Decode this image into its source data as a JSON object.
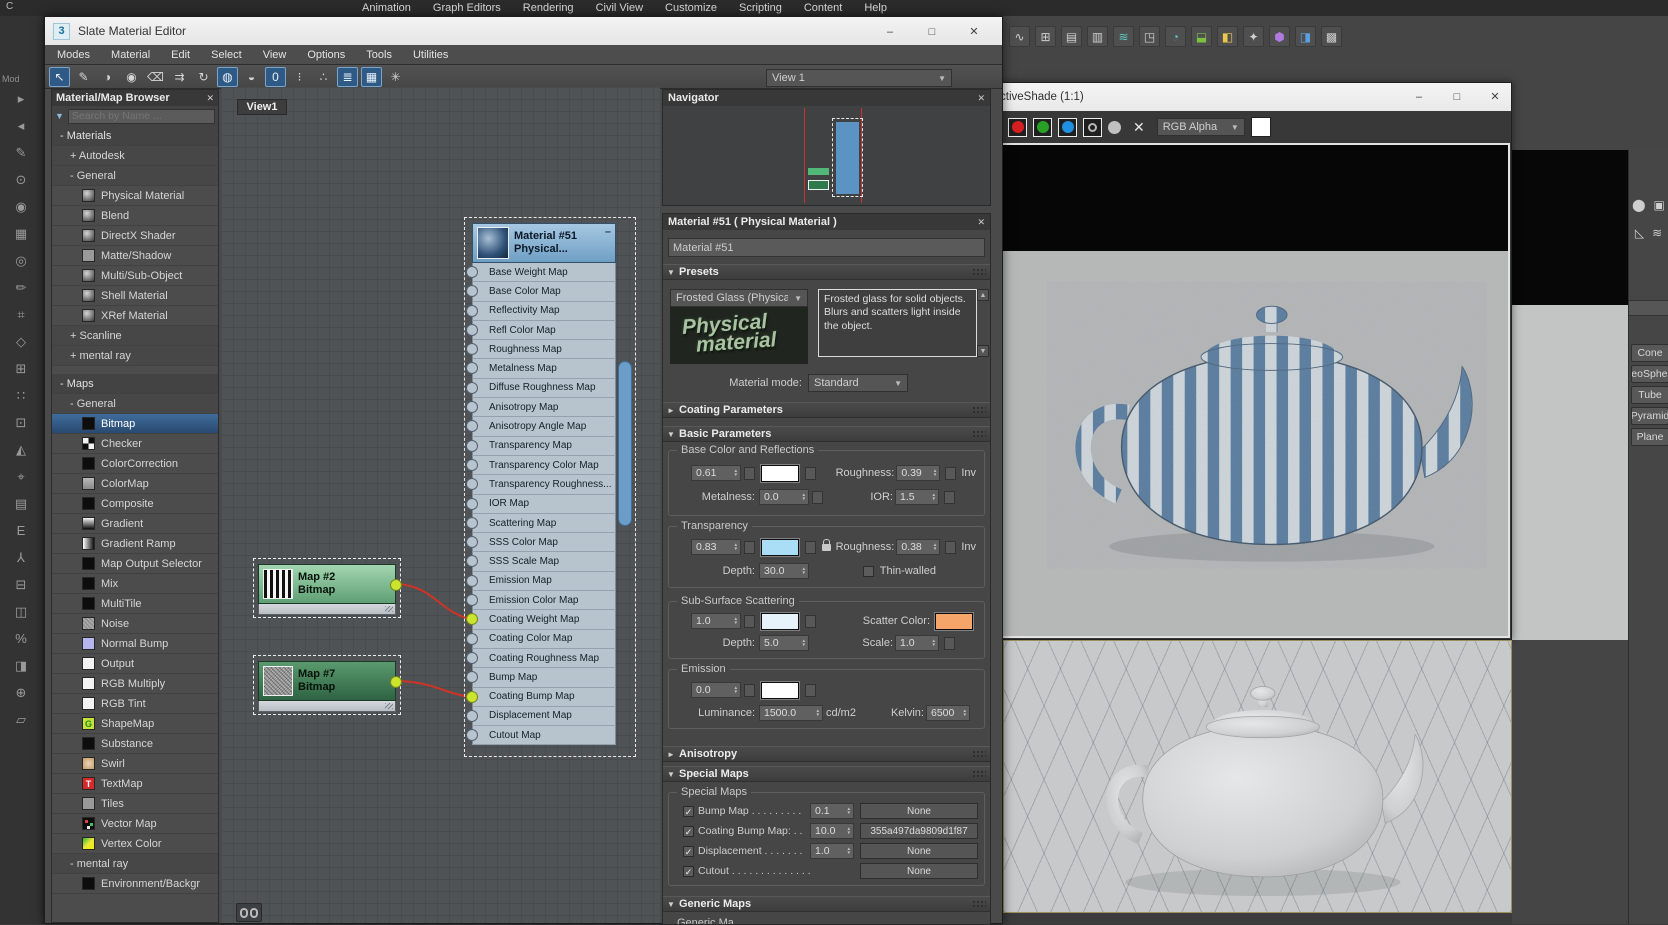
{
  "main_window": {
    "menubar": [
      "Animation",
      "Graph Editors",
      "Rendering",
      "Civil View",
      "Customize",
      "Scripting",
      "Content",
      "Help"
    ],
    "corner_text": "C",
    "mod_text": "Mod",
    "toolbar_icons": [
      {
        "name": "curve-editor-icon",
        "g": "∿",
        "c": ""
      },
      {
        "name": "schematic-view-icon",
        "g": "⊞",
        "c": ""
      },
      {
        "name": "layer-manager-icon",
        "g": "▤",
        "c": ""
      },
      {
        "name": "ribbon-icon",
        "g": "▥",
        "c": ""
      },
      {
        "name": "array-icon",
        "g": "≋",
        "c": "tc-teal"
      },
      {
        "name": "align-icon",
        "g": "◳",
        "c": ""
      },
      {
        "name": "render-setup-icon",
        "g": "◔",
        "c": "tc-teal"
      },
      {
        "name": "rendered-frame-icon",
        "g": "⬓",
        "c": "tc-green"
      },
      {
        "name": "render-production-icon",
        "g": "◧",
        "c": "tc-yellow"
      },
      {
        "name": "render-iterative-icon",
        "g": "✦",
        "c": ""
      },
      {
        "name": "material-editor-icon",
        "g": "⬢",
        "c": "tc-purple"
      },
      {
        "name": "render-preview-icon",
        "g": "◨",
        "c": "tc-blue"
      },
      {
        "name": "grid-icon",
        "g": "▩",
        "c": ""
      }
    ],
    "left_strip_icons": [
      "▸",
      "◂",
      "✎",
      "⊙",
      "◉",
      "▦",
      "◎",
      "✏",
      "⌗",
      "◇",
      "⊞",
      "∷",
      "⊡",
      "◭",
      "⌖",
      "▤",
      "E",
      "⅄",
      "⊟",
      "◫",
      "%",
      "◨",
      "⊕",
      "▱"
    ]
  },
  "command_panel": {
    "icons_row1": [
      "⬤",
      "▣"
    ],
    "icons_row2": [
      "◺",
      "≋"
    ],
    "buttons": [
      "Cone",
      "GeoSphere",
      "Tube",
      "Pyramid",
      "Plane"
    ]
  },
  "slate": {
    "title": "Slate Material Editor",
    "win_min": "–",
    "win_max": "□",
    "win_close": "✕",
    "menubar": [
      "Modes",
      "Material",
      "Edit",
      "Select",
      "View",
      "Options",
      "Tools",
      "Utilities"
    ],
    "toolbar_icons": [
      {
        "name": "select-tool-icon",
        "g": "↖",
        "cls": "pressed"
      },
      {
        "name": "pick-material-icon",
        "g": "✎",
        "cls": ""
      },
      {
        "name": "put-to-library-icon",
        "g": "◑",
        "cls": ""
      },
      {
        "name": "assign-material-icon",
        "g": "◉",
        "cls": ""
      },
      {
        "name": "delete-selected-icon",
        "g": "⌫",
        "cls": ""
      },
      {
        "name": "move-children-icon",
        "g": "⇉",
        "cls": ""
      },
      {
        "name": "update-preview-icon",
        "g": "↻",
        "cls": ""
      },
      {
        "name": "show-map-in-viewport-icon",
        "g": "◍",
        "cls": "pressed"
      },
      {
        "name": "show-background-icon",
        "g": "◒",
        "cls": ""
      },
      {
        "name": "show-numbers-icon",
        "g": "0",
        "cls": "pressed"
      },
      {
        "name": "layout-vertical-icon",
        "g": "⁝",
        "cls": ""
      },
      {
        "name": "layout-children-icon",
        "g": "∴",
        "cls": ""
      },
      {
        "name": "material-id-list-icon",
        "g": "≣",
        "cls": "pressed"
      },
      {
        "name": "grid-toggle-icon",
        "g": "▦",
        "cls": "pressed"
      },
      {
        "name": "select-by-material-icon",
        "g": "✳",
        "cls": ""
      }
    ],
    "view_selector": "View 1",
    "view_tab": "View1"
  },
  "browser": {
    "title": "Material/Map Browser",
    "close": "✕",
    "search_placeholder": "Search by Name ...",
    "rows": [
      {
        "row": "sec",
        "label": "- Materials"
      },
      {
        "row": "grp",
        "label": "+ Autodesk"
      },
      {
        "row": "grp",
        "label": "- General"
      },
      {
        "row": "itm",
        "icon": "ic-sphere",
        "label": "Physical Material"
      },
      {
        "row": "itm",
        "icon": "ic-sphere",
        "label": "Blend"
      },
      {
        "row": "itm",
        "icon": "ic-sphere",
        "label": "DirectX Shader"
      },
      {
        "row": "itm",
        "icon": "ic-flat",
        "label": "Matte/Shadow"
      },
      {
        "row": "itm",
        "icon": "ic-sphere",
        "label": "Multi/Sub-Object"
      },
      {
        "row": "itm",
        "icon": "ic-sphere",
        "label": "Shell Material"
      },
      {
        "row": "itm",
        "icon": "ic-sphere",
        "label": "XRef Material"
      },
      {
        "row": "grp",
        "label": "+ Scanline"
      },
      {
        "row": "grp",
        "label": "+ mental ray"
      },
      {
        "row": "sp",
        "label": ""
      },
      {
        "row": "sec",
        "label": "- Maps"
      },
      {
        "row": "grp",
        "label": "- General"
      },
      {
        "row": "itm sel",
        "icon": "ic-black",
        "label": "Bitmap"
      },
      {
        "row": "itm",
        "icon": "ic-checker",
        "label": "Checker"
      },
      {
        "row": "itm",
        "icon": "ic-black",
        "label": "ColorCorrection"
      },
      {
        "row": "itm",
        "icon": "ic-grayblock",
        "label": "ColorMap"
      },
      {
        "row": "itm",
        "icon": "ic-black",
        "label": "Composite"
      },
      {
        "row": "itm",
        "icon": "ic-gradient",
        "label": "Gradient"
      },
      {
        "row": "itm",
        "icon": "ic-gradientramp",
        "label": "Gradient Ramp"
      },
      {
        "row": "itm",
        "icon": "ic-black",
        "label": "Map Output Selector"
      },
      {
        "row": "itm",
        "icon": "ic-black",
        "label": "Mix"
      },
      {
        "row": "itm",
        "icon": "ic-black",
        "label": "MultiTile"
      },
      {
        "row": "itm",
        "icon": "ic-noise",
        "label": "Noise"
      },
      {
        "row": "itm",
        "icon": "ic-lavender",
        "label": "Normal Bump"
      },
      {
        "row": "itm",
        "icon": "ic-white",
        "label": "Output"
      },
      {
        "row": "itm",
        "icon": "ic-white",
        "label": "RGB Multiply"
      },
      {
        "row": "itm",
        "icon": "ic-white",
        "label": "RGB Tint"
      },
      {
        "row": "itm",
        "icon": "ic-shapemap",
        "label": "ShapeMap"
      },
      {
        "row": "itm",
        "icon": "ic-black",
        "label": "Substance"
      },
      {
        "row": "itm",
        "icon": "ic-swirl",
        "label": "Swirl"
      },
      {
        "row": "itm",
        "icon": "ic-textmap",
        "label": "TextMap"
      },
      {
        "row": "itm",
        "icon": "ic-tiles",
        "label": "Tiles"
      },
      {
        "row": "itm",
        "icon": "ic-vector",
        "label": "Vector Map"
      },
      {
        "row": "itm",
        "icon": "ic-vertex",
        "label": "Vertex Color"
      },
      {
        "row": "grp",
        "label": "- mental ray"
      },
      {
        "row": "itm",
        "icon": "ic-black",
        "label": "Environment/Backgr"
      }
    ]
  },
  "node_view": {
    "material_node": {
      "title": "Material #51",
      "subtitle": "Physical...",
      "minimize_glyph": "–",
      "slots": [
        {
          "label": "Base Weight Map",
          "sock": ""
        },
        {
          "label": "Base Color Map",
          "sock": ""
        },
        {
          "label": "Reflectivity Map",
          "sock": ""
        },
        {
          "label": "Refl Color Map",
          "sock": ""
        },
        {
          "label": "Roughness Map",
          "sock": ""
        },
        {
          "label": "Metalness Map",
          "sock": ""
        },
        {
          "label": "Diffuse Roughness Map",
          "sock": ""
        },
        {
          "label": "Anisotropy Map",
          "sock": ""
        },
        {
          "label": "Anisotropy Angle Map",
          "sock": ""
        },
        {
          "label": "Transparency Map",
          "sock": ""
        },
        {
          "label": "Transparency Color Map",
          "sock": ""
        },
        {
          "label": "Transparency Roughness...",
          "sock": ""
        },
        {
          "label": "IOR Map",
          "sock": ""
        },
        {
          "label": "Scattering Map",
          "sock": ""
        },
        {
          "label": "SSS Color Map",
          "sock": ""
        },
        {
          "label": "SSS Scale Map",
          "sock": ""
        },
        {
          "label": "Emission Map",
          "sock": ""
        },
        {
          "label": "Emission Color Map",
          "sock": ""
        },
        {
          "label": "Coating Weight Map",
          "sock": "connected"
        },
        {
          "label": "Coating Color Map",
          "sock": ""
        },
        {
          "label": "Coating Roughness Map",
          "sock": ""
        },
        {
          "label": "Bump Map",
          "sock": ""
        },
        {
          "label": "Coating Bump Map",
          "sock": "connected"
        },
        {
          "label": "Displacement Map",
          "sock": ""
        },
        {
          "label": "Cutout Map",
          "sock": ""
        }
      ]
    },
    "map2": {
      "title": "Map #2",
      "subtitle": "Bitmap"
    },
    "map7": {
      "title": "Map #7",
      "subtitle": "Bitmap"
    }
  },
  "navigator": {
    "title": "Navigator",
    "close": "✕"
  },
  "params": {
    "header": "Material #51  ( Physical Material )",
    "close": "✕",
    "name": "Material #51",
    "presets": {
      "label": "Presets",
      "arrow": "▼",
      "preset_value": "Frosted Glass (Physical",
      "description": "Frosted glass for solid objects. Blurs and scatters light inside the object.",
      "image_line1": "Physical",
      "image_line2": "material",
      "mode_label": "Material mode:",
      "mode_value": "Standard"
    },
    "rollouts": {
      "coating": {
        "label": "Coating Parameters",
        "arrow": "►"
      },
      "basic": {
        "label": "Basic Parameters",
        "arrow": "▼"
      },
      "anisotropy": {
        "label": "Anisotropy",
        "arrow": "►"
      },
      "special": {
        "label": "Special Maps",
        "arrow": "▼"
      },
      "generic": {
        "label": "Generic Maps",
        "arrow": "▼"
      }
    },
    "basic": {
      "group1": "Base Color and Reflections",
      "base_weight": "0.61",
      "base_color": "#ffffff",
      "roughness_label": "Roughness:",
      "roughness": "0.39",
      "inv": "Inv",
      "metalness_label": "Metalness:",
      "metalness": "0.0",
      "ior_label": "IOR:",
      "ior": "1.5"
    },
    "transparency": {
      "group": "Transparency",
      "weight": "0.83",
      "color": "#a9def6",
      "roughness_label": "Roughness:",
      "roughness": "0.38",
      "inv": "Inv",
      "depth_label": "Depth:",
      "depth": "30.0",
      "thin_walled": "Thin-walled"
    },
    "sss": {
      "group": "Sub-Surface Scattering",
      "weight": "1.0",
      "color": "#e6f3fb",
      "scatter_label": "Scatter Color:",
      "scatter_color": "#f5a569",
      "depth_label": "Depth:",
      "depth": "5.0",
      "scale_label": "Scale:",
      "scale": "1.0"
    },
    "emission": {
      "group": "Emission",
      "weight": "0.0",
      "color": "#ffffff",
      "luminance_label": "Luminance:",
      "luminance": "1500.0",
      "unit": "cd/m2",
      "kelvin_label": "Kelvin:",
      "kelvin": "6500"
    },
    "special_maps": {
      "group": "Special Maps",
      "rows": [
        {
          "check": "✓",
          "label": "Bump Map . . . . . . . . .",
          "value": "0.1",
          "btn": "None",
          "cls": ""
        },
        {
          "check": "✓",
          "label": "Coating Bump Map: . .",
          "value": "10.0",
          "btn": "355a497da9809d1f87",
          "cls": ""
        },
        {
          "check": "✓",
          "label": "Displacement . . . . . . .",
          "value": "1.0",
          "btn": "None",
          "cls": ""
        },
        {
          "check": "✓",
          "label": "Cutout . . . . . . . . . . . . . . . . .",
          "value": "",
          "btn": "None",
          "cls": "nospin"
        }
      ]
    },
    "generic_partial": "Generic Ma"
  },
  "activeshade": {
    "title": "ctiveShade (1:1)",
    "win_min": "–",
    "win_max": "□",
    "win_close": "✕",
    "clear_glyph": "✕",
    "channel_value": "RGB Alpha",
    "swatch_color": "#ffffff"
  }
}
